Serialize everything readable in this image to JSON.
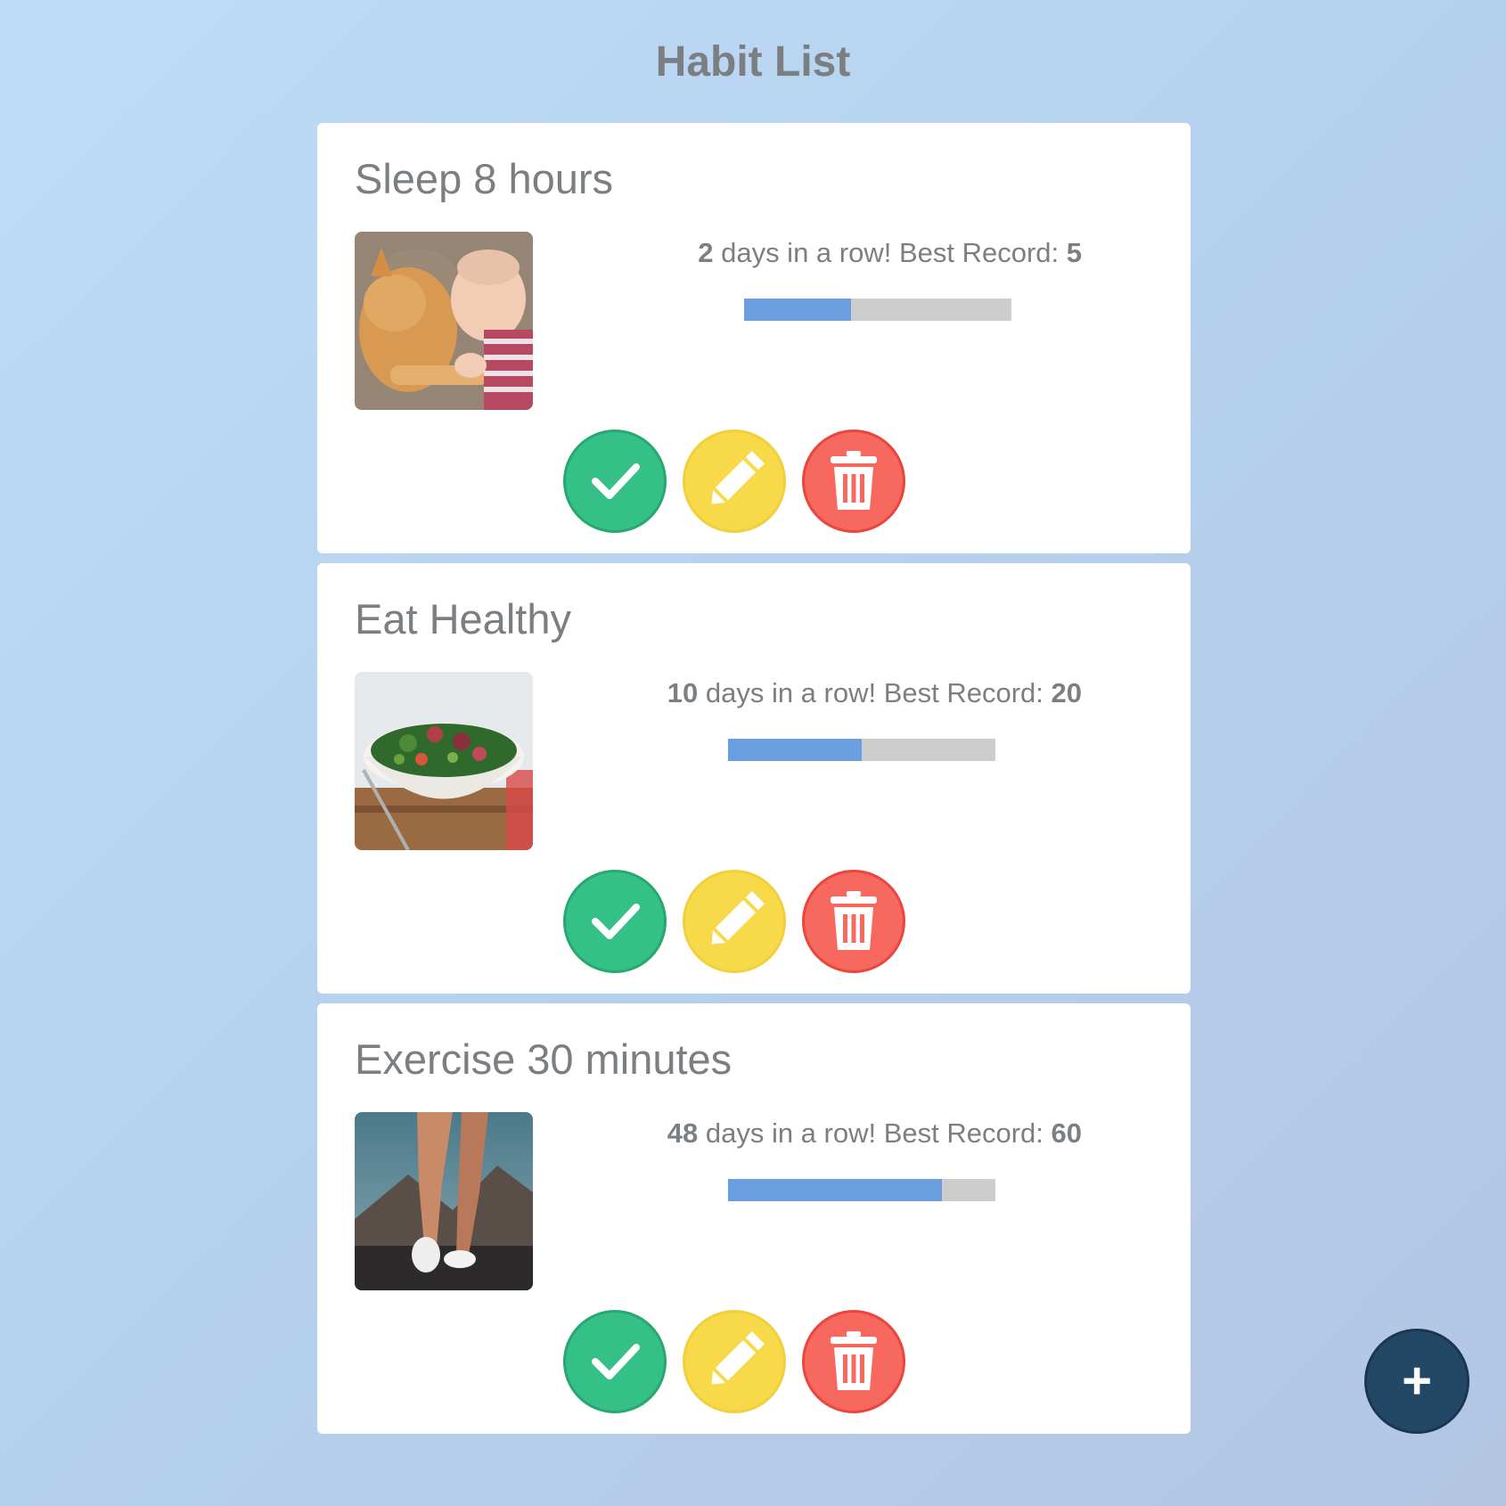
{
  "page": {
    "title": "Habit List"
  },
  "habits": [
    {
      "name": "Sleep 8 hours",
      "image_alt": "cat and baby sleeping",
      "streak": "2",
      "streak_label": " days in a row! Best Record: ",
      "best": "5",
      "progress": 0.4
    },
    {
      "name": "Eat Healthy",
      "image_alt": "bowl of salad",
      "streak": "10",
      "streak_label": " days in a row! Best Record: ",
      "best": "20",
      "progress": 0.5
    },
    {
      "name": "Exercise 30 minutes",
      "image_alt": "runner's legs",
      "streak": "48",
      "streak_label": " days in a row! Best Record: ",
      "best": "60",
      "progress": 0.8
    }
  ],
  "actions": {
    "complete_icon": "checkmark-icon",
    "edit_icon": "pencil-icon",
    "delete_icon": "trash-icon"
  },
  "fab": {
    "label": "+",
    "icon": "plus-icon"
  },
  "colors": {
    "complete": "#35c088",
    "edit": "#f8d94a",
    "delete": "#f7685f",
    "progress_fill": "#6a9ee0",
    "progress_track": "#cdcdcd",
    "fab": "#234865"
  }
}
